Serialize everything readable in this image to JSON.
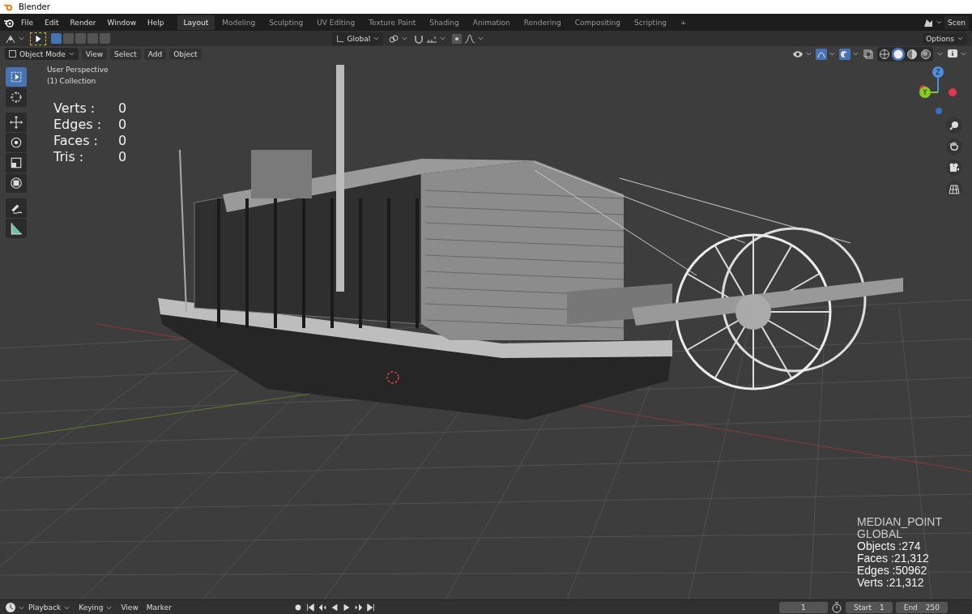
{
  "window": {
    "title": "Blender"
  },
  "menu": [
    "File",
    "Edit",
    "Render",
    "Window",
    "Help"
  ],
  "workspaces": [
    {
      "label": "Layout",
      "selected": true
    },
    {
      "label": "Modeling",
      "selected": false
    },
    {
      "label": "Sculpting",
      "selected": false
    },
    {
      "label": "UV Editing",
      "selected": false
    },
    {
      "label": "Texture Paint",
      "selected": false
    },
    {
      "label": "Shading",
      "selected": false
    },
    {
      "label": "Animation",
      "selected": false
    },
    {
      "label": "Rendering",
      "selected": false
    },
    {
      "label": "Compositing",
      "selected": false
    },
    {
      "label": "Scripting",
      "selected": false
    }
  ],
  "add_workspace": "+",
  "scene": "Scen",
  "tool_header": {
    "select_modes": [
      {
        "selected": true
      },
      {
        "selected": false
      },
      {
        "selected": false
      },
      {
        "selected": false
      },
      {
        "selected": false
      }
    ],
    "orientation": "Global",
    "options": "Options"
  },
  "viewport_header": {
    "mode": "Object Mode",
    "menus": [
      "View",
      "Select",
      "Add",
      "Object"
    ],
    "shading": [
      {
        "kind": "wireframe",
        "selected": false
      },
      {
        "kind": "solid",
        "selected": true
      },
      {
        "kind": "material",
        "selected": false
      },
      {
        "kind": "rendered",
        "selected": false
      }
    ]
  },
  "tools": [
    {
      "kind": "select",
      "selected": true
    },
    {
      "kind": "cursor",
      "selected": false
    },
    {
      "kind": "move",
      "selected": false
    },
    {
      "kind": "rotate",
      "selected": false
    },
    {
      "kind": "scale",
      "selected": false
    },
    {
      "kind": "transform",
      "selected": false
    },
    {
      "kind": "annotate",
      "selected": false
    },
    {
      "kind": "measure",
      "selected": false
    }
  ],
  "viewport": {
    "perspective": "User Perspective",
    "collection": "(1) Collection",
    "stats": [
      {
        "label": "Verts :",
        "value": "0"
      },
      {
        "label": "Edges :",
        "value": "0"
      },
      {
        "label": "Faces :",
        "value": "0"
      },
      {
        "label": "Tris :",
        "value": "0"
      }
    ],
    "gizmo": {
      "z": "Z",
      "y": "Y"
    },
    "info": [
      "MEDIAN_POINT",
      "GLOBAL",
      "Objects :274",
      "Faces :21,312",
      "Edges :50962",
      "Verts :21,312"
    ]
  },
  "timeline": {
    "menus": [
      "Playback",
      "Keying",
      "View",
      "Marker"
    ],
    "current_frame": "1",
    "start_label": "Start",
    "start": "1",
    "end_label": "End",
    "end": "250"
  }
}
